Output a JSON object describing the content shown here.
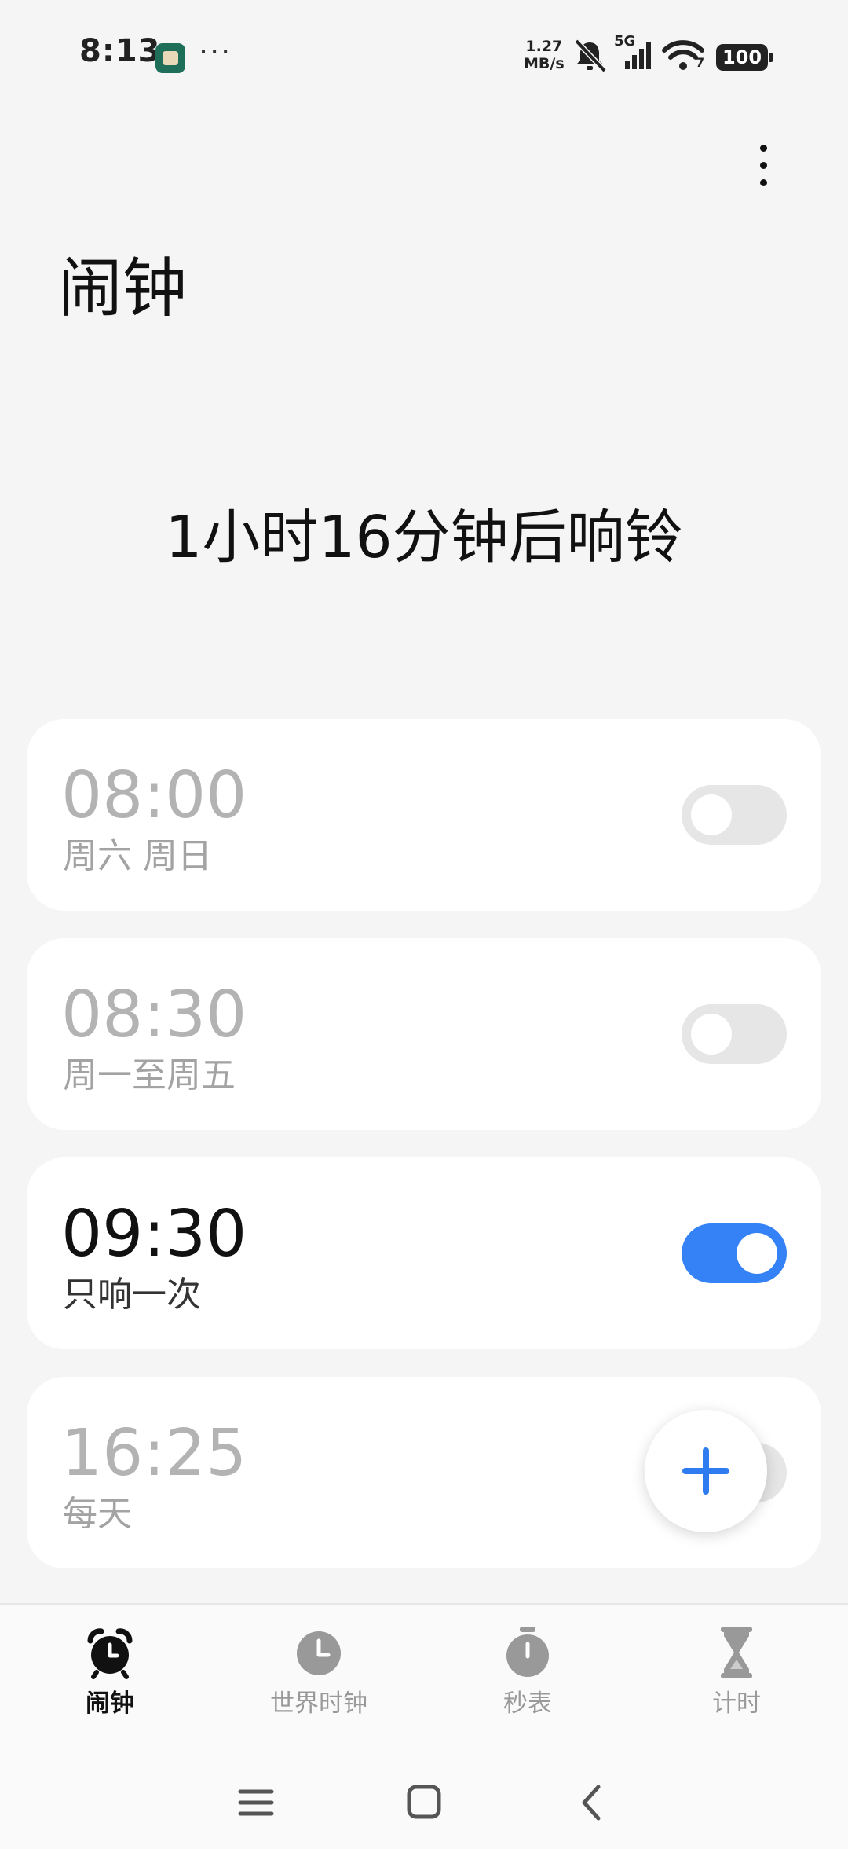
{
  "status_bar": {
    "time": "8:13",
    "net_speed_value": "1.27",
    "net_speed_unit": "MB/s",
    "network_type": "5G",
    "wifi_label": "7",
    "battery": "100"
  },
  "header": {
    "title": "闹钟",
    "next_ring": "1小时16分钟后响铃"
  },
  "alarms": [
    {
      "time": "08:00",
      "repeat": "周六 周日",
      "enabled": false
    },
    {
      "time": "08:30",
      "repeat": "周一至周五",
      "enabled": false
    },
    {
      "time": "09:30",
      "repeat": "只响一次",
      "enabled": true
    },
    {
      "time": "16:25",
      "repeat": "每天",
      "enabled": false
    }
  ],
  "bottom_nav": {
    "items": [
      {
        "label": "闹钟",
        "icon": "alarm-clock-icon",
        "active": true
      },
      {
        "label": "世界时钟",
        "icon": "clock-icon",
        "active": false
      },
      {
        "label": "秒表",
        "icon": "stopwatch-icon",
        "active": false
      },
      {
        "label": "计时",
        "icon": "hourglass-icon",
        "active": false
      }
    ]
  },
  "colors": {
    "accent": "#3482f6",
    "background": "#f5f5f5",
    "card": "#ffffff",
    "disabled_text": "#b3b3b3"
  }
}
